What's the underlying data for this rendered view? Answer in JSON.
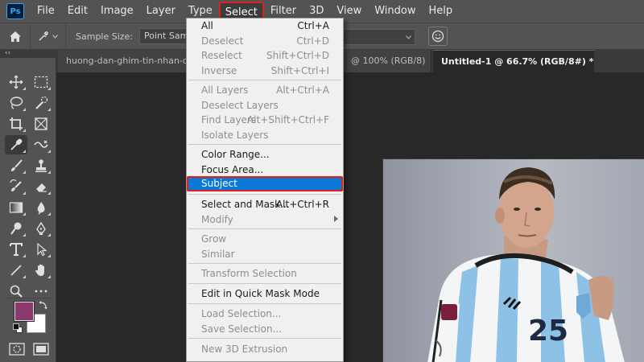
{
  "app": {
    "logo": "Ps"
  },
  "menubar": {
    "items": [
      "File",
      "Edit",
      "Image",
      "Layer",
      "Type",
      "Select",
      "Filter",
      "3D",
      "View",
      "Window",
      "Help"
    ],
    "active": "Select"
  },
  "options": {
    "sample_size_label": "Sample Size:",
    "sample_size_value": "Point Sample"
  },
  "tabs": {
    "collapse": "‹‹",
    "tab1": "huong-dan-ghim-tin-nhan-q",
    "tab2": "@ 100% (RGB/8)",
    "tab3": "Untitled-1 @ 66.7% (RGB/8#) *",
    "close": "×"
  },
  "select_menu": {
    "group1": [
      {
        "label": "All",
        "shortcut": "Ctrl+A",
        "enabled": true
      },
      {
        "label": "Deselect",
        "shortcut": "Ctrl+D",
        "enabled": false
      },
      {
        "label": "Reselect",
        "shortcut": "Shift+Ctrl+D",
        "enabled": false
      },
      {
        "label": "Inverse",
        "shortcut": "Shift+Ctrl+I",
        "enabled": false
      }
    ],
    "group2": [
      {
        "label": "All Layers",
        "shortcut": "Alt+Ctrl+A",
        "enabled": false
      },
      {
        "label": "Deselect Layers",
        "shortcut": "",
        "enabled": false
      },
      {
        "label": "Find Layers",
        "shortcut": "Alt+Shift+Ctrl+F",
        "enabled": false
      },
      {
        "label": "Isolate Layers",
        "shortcut": "",
        "enabled": false
      }
    ],
    "group3": [
      {
        "label": "Color Range...",
        "shortcut": "",
        "enabled": true
      },
      {
        "label": "Focus Area...",
        "shortcut": "",
        "enabled": true
      },
      {
        "label": "Subject",
        "shortcut": "",
        "enabled": true,
        "highlighted": true
      }
    ],
    "group4": [
      {
        "label": "Select and Mask...",
        "shortcut": "Alt+Ctrl+R",
        "enabled": true
      },
      {
        "label": "Modify",
        "shortcut": "",
        "enabled": false,
        "submenu": true
      }
    ],
    "group5": [
      {
        "label": "Grow",
        "shortcut": "",
        "enabled": false
      },
      {
        "label": "Similar",
        "shortcut": "",
        "enabled": false
      }
    ],
    "group6": [
      {
        "label": "Transform Selection",
        "shortcut": "",
        "enabled": false
      }
    ],
    "group7": [
      {
        "label": "Edit in Quick Mask Mode",
        "shortcut": "",
        "enabled": true
      }
    ],
    "group8": [
      {
        "label": "Load Selection...",
        "shortcut": "",
        "enabled": false
      },
      {
        "label": "Save Selection...",
        "shortcut": "",
        "enabled": false
      }
    ],
    "group9": [
      {
        "label": "New 3D Extrusion",
        "shortcut": "",
        "enabled": false
      }
    ]
  },
  "colors": {
    "foreground": "#8a3a6c",
    "background": "#ffffff",
    "highlight": "#0a78d4",
    "annotation_red": "#e0201a"
  },
  "icons": {
    "toolbar": [
      "move-icon",
      "marquee-icon",
      "lasso-icon",
      "quick-select-icon",
      "crop-icon",
      "frame-icon",
      "eyedropper-icon",
      "healing-icon",
      "brush-icon",
      "stamp-icon",
      "history-brush-icon",
      "eraser-icon",
      "gradient-icon",
      "blur-icon",
      "dodge-icon",
      "pen-icon",
      "type-icon",
      "path-select-icon",
      "line-icon",
      "hand-icon",
      "zoom-icon"
    ]
  }
}
